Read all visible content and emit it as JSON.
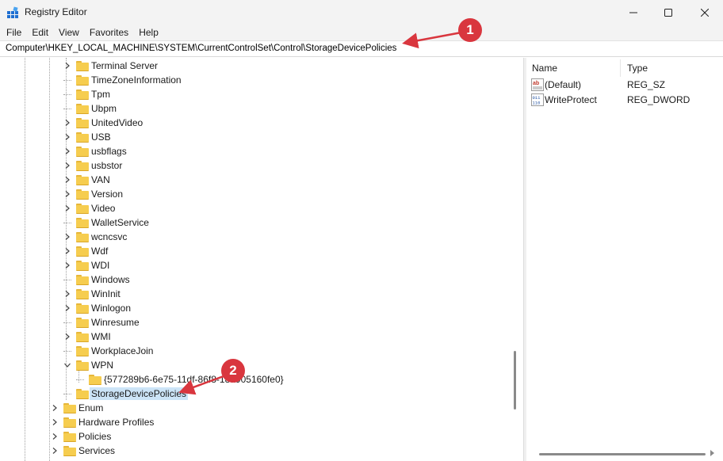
{
  "window": {
    "title": "Registry Editor",
    "minimize_glyph": "—",
    "maximize_glyph": "▢",
    "close_glyph": "✕"
  },
  "menu": [
    "File",
    "Edit",
    "View",
    "Favorites",
    "Help"
  ],
  "address": "Computer\\HKEY_LOCAL_MACHINE\\SYSTEM\\CurrentControlSet\\Control\\StorageDevicePolicies",
  "tree": [
    {
      "label": "Terminal Server",
      "expander": "collapsed"
    },
    {
      "label": "TimeZoneInformation",
      "expander": "none"
    },
    {
      "label": "Tpm",
      "expander": "none"
    },
    {
      "label": "Ubpm",
      "expander": "none"
    },
    {
      "label": "UnitedVideo",
      "expander": "collapsed"
    },
    {
      "label": "USB",
      "expander": "collapsed"
    },
    {
      "label": "usbflags",
      "expander": "collapsed"
    },
    {
      "label": "usbstor",
      "expander": "collapsed"
    },
    {
      "label": "VAN",
      "expander": "collapsed"
    },
    {
      "label": "Version",
      "expander": "collapsed"
    },
    {
      "label": "Video",
      "expander": "collapsed"
    },
    {
      "label": "WalletService",
      "expander": "none"
    },
    {
      "label": "wcncsvc",
      "expander": "collapsed"
    },
    {
      "label": "Wdf",
      "expander": "collapsed"
    },
    {
      "label": "WDI",
      "expander": "collapsed"
    },
    {
      "label": "Windows",
      "expander": "none"
    },
    {
      "label": "WinInit",
      "expander": "collapsed"
    },
    {
      "label": "Winlogon",
      "expander": "collapsed"
    },
    {
      "label": "Winresume",
      "expander": "none"
    },
    {
      "label": "WMI",
      "expander": "collapsed"
    },
    {
      "label": "WorkplaceJoin",
      "expander": "none"
    },
    {
      "label": "WPN",
      "expander": "expanded"
    },
    {
      "label": "{577289b6-6e75-11df-86f8-18a905160fe0}",
      "expander": "none"
    },
    {
      "label": "StorageDevicePolicies",
      "expander": "none",
      "selected": true
    },
    {
      "label": "Enum",
      "expander": "collapsed"
    },
    {
      "label": "Hardware Profiles",
      "expander": "collapsed"
    },
    {
      "label": "Policies",
      "expander": "collapsed"
    },
    {
      "label": "Services",
      "expander": "collapsed"
    }
  ],
  "list": {
    "columns": {
      "name": "Name",
      "type": "Type"
    },
    "values": [
      {
        "name": "(Default)",
        "type": "REG_SZ",
        "icon": "string-value-icon"
      },
      {
        "name": "WriteProtect",
        "type": "REG_DWORD",
        "icon": "binary-value-icon"
      }
    ]
  },
  "annotations": [
    {
      "label": "1"
    },
    {
      "label": "2"
    }
  ],
  "colors": {
    "annotation": "#d9363e",
    "selection": "#cce4f7",
    "folder": "#f6cd4f"
  }
}
